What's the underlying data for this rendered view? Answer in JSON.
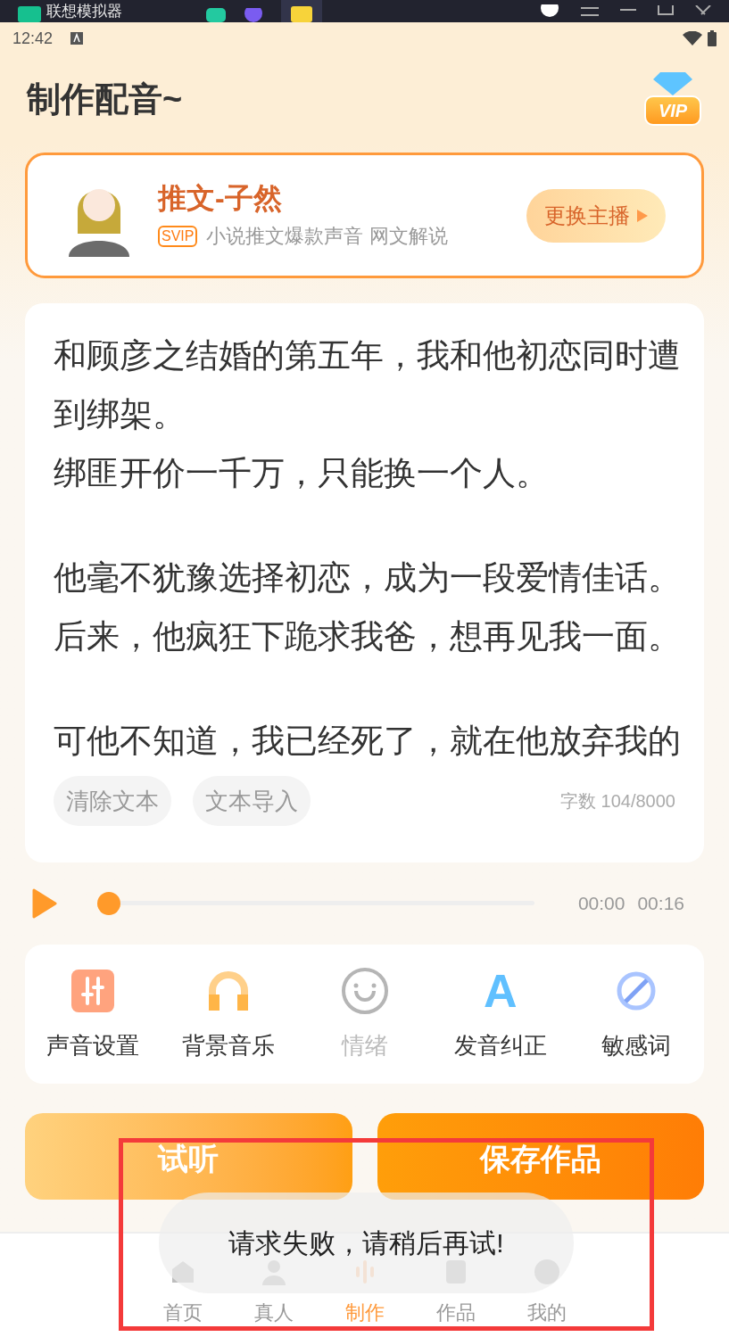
{
  "emulator_bar": {
    "title": "联想模拟器"
  },
  "status_bar": {
    "time": "12:42"
  },
  "header": {
    "title": "制作配音~",
    "vip_badge": "VIP"
  },
  "voice_card": {
    "name": "推文-子然",
    "tier": "SVIP",
    "description": "小说推文爆款声音 网文解说",
    "change_button": "更换主播"
  },
  "editor": {
    "paragraphs": [
      [
        "和顾彦之结婚的第五年，我和他初恋同时遭到绑架。",
        "绑匪开价一千万，只能换一个人。"
      ],
      [
        "他毫不犹豫选择初恋，成为一段爱情佳话。",
        "后来，他疯狂下跪求我爸，想再见我一面。"
      ],
      [
        "可他不知道，我已经死了，就在他放弃我的"
      ]
    ],
    "buttons": [
      "清除文本",
      "文本导入"
    ],
    "word_count": "字数 104/8000"
  },
  "player": {
    "level": 0,
    "current": "00:00",
    "total": "00:16"
  },
  "tools": [
    {
      "kind": "sliders",
      "label": "声音设置",
      "disabled": false
    },
    {
      "kind": "headphones",
      "label": "背景音乐",
      "disabled": false
    },
    {
      "kind": "smile",
      "label": "情绪",
      "disabled": true
    },
    {
      "kind": "letter",
      "label": "发音纠正",
      "disabled": false,
      "glyph": "A"
    },
    {
      "kind": "ban",
      "label": "敏感词",
      "disabled": false
    }
  ],
  "actions": [
    {
      "kind": "light",
      "label": "试听"
    },
    {
      "kind": "strong",
      "label": "保存作品"
    }
  ],
  "toast": "请求失败，请稍后再试!",
  "nav": [
    {
      "kind": "home",
      "label": "首页",
      "selected": false
    },
    {
      "kind": "person",
      "label": "真人",
      "selected": false
    },
    {
      "kind": "wave",
      "label": "制作",
      "selected": true
    },
    {
      "kind": "doc",
      "label": "作品",
      "selected": false
    },
    {
      "kind": "face",
      "label": "我的",
      "selected": false
    }
  ]
}
